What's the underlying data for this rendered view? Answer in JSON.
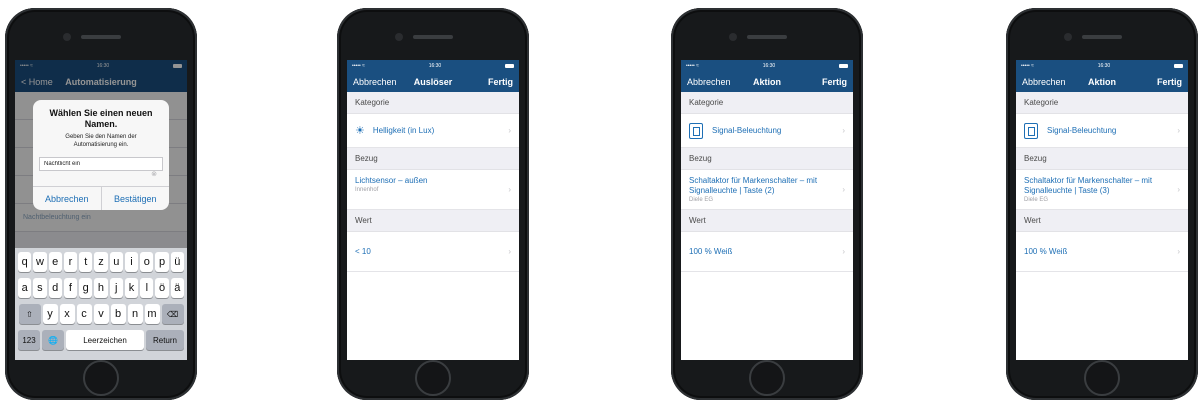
{
  "status_bar": {
    "signal": "••••• ≈",
    "time": "16:30"
  },
  "phone1": {
    "nav": {
      "back_label": "< Home",
      "title": "Automatisierung"
    },
    "background_row": "Nachtbeleuchtung ein",
    "alert": {
      "title": "Wählen Sie einen neuen Namen.",
      "message": "Geben Sie den Namen der Automatisierung ein.",
      "input_value": "Nachtlicht ein",
      "cancel_label": "Abbrechen",
      "confirm_label": "Bestätigen"
    },
    "keyboard": {
      "row1": [
        "q",
        "w",
        "e",
        "r",
        "t",
        "z",
        "u",
        "i",
        "o",
        "p",
        "ü"
      ],
      "row2": [
        "a",
        "s",
        "d",
        "f",
        "g",
        "h",
        "j",
        "k",
        "l",
        "ö",
        "ä"
      ],
      "row3": [
        "y",
        "x",
        "c",
        "v",
        "b",
        "n",
        "m"
      ],
      "shift": "⇧",
      "delete": "⌫",
      "numbers": "123",
      "globe": "🌐",
      "space": "Leerzeichen",
      "return": "Return"
    }
  },
  "phone2": {
    "nav": {
      "left": "Abbrechen",
      "title": "Auslöser",
      "right": "Fertig"
    },
    "category_header": "Kategorie",
    "category_value": "Helligkeit (in Lux)",
    "category_icon": "sun-icon",
    "reference_header": "Bezug",
    "reference_title": "Lichtsensor – außen",
    "reference_subtitle": "Innenhof",
    "value_header": "Wert",
    "value": "< 10"
  },
  "phone3": {
    "nav": {
      "left": "Abbrechen",
      "title": "Aktion",
      "right": "Fertig"
    },
    "category_header": "Kategorie",
    "category_value": "Signal-Beleuchtung",
    "category_icon": "signal-light-icon",
    "reference_header": "Bezug",
    "reference_title": "Schaltaktor für Markenschalter – mit Signalleuchte | Taste (2)",
    "reference_subtitle": "Diele EG",
    "value_header": "Wert",
    "value": "100 % Weiß"
  },
  "phone4": {
    "nav": {
      "left": "Abbrechen",
      "title": "Aktion",
      "right": "Fertig"
    },
    "category_header": "Kategorie",
    "category_value": "Signal-Beleuchtung",
    "category_icon": "signal-light-icon",
    "reference_header": "Bezug",
    "reference_title": "Schaltaktor für Markenschalter – mit Signalleuchte | Taste (3)",
    "reference_subtitle": "Diele EG",
    "value_header": "Wert",
    "value": "100 % Weiß"
  },
  "colors": {
    "nav_bar": "#1a4f80",
    "link": "#1e6fb5",
    "grouped_bg": "#efeff4"
  }
}
